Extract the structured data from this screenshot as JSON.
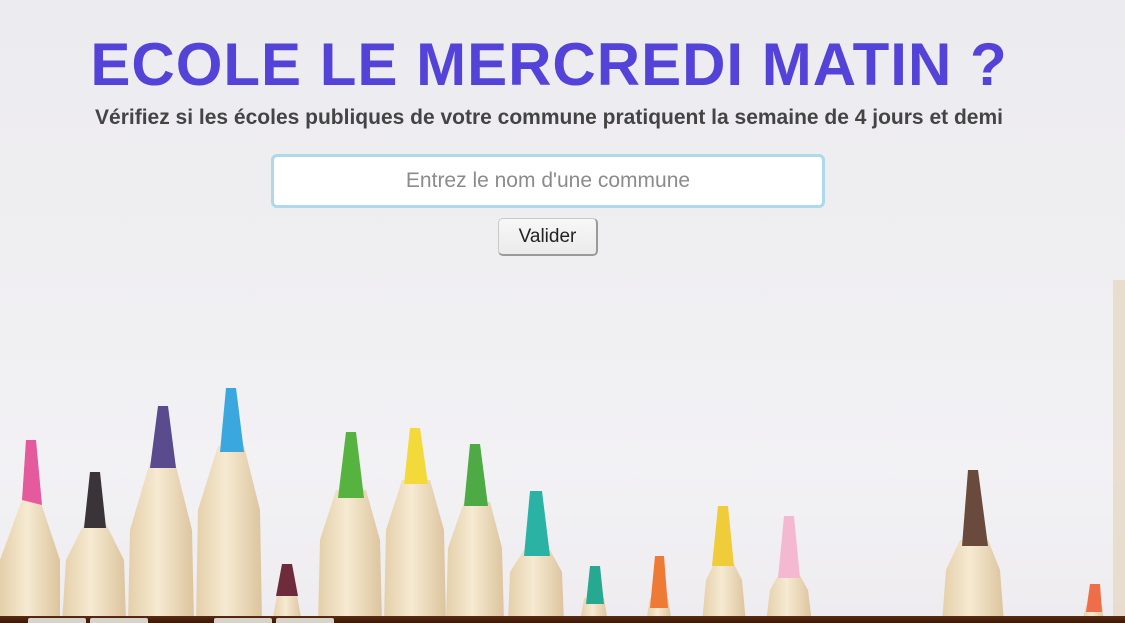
{
  "header": {
    "title": "ECOLE LE MERCREDI MATIN ?",
    "subtitle": "Vérifiez si les écoles publiques de votre commune pratiquent la semaine de 4 jours et demi"
  },
  "search": {
    "value": "",
    "placeholder": "Entrez le nom d'une commune"
  },
  "submit": {
    "label": "Valider"
  },
  "colors": {
    "title": "#5443d8",
    "subtitle": "#444444",
    "input_border": "#aed9ec"
  }
}
